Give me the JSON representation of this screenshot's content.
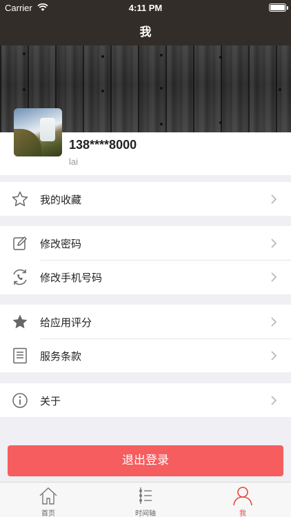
{
  "status_bar": {
    "carrier": "Carrier",
    "time": "4:11 PM"
  },
  "nav": {
    "title": "我"
  },
  "profile": {
    "phone": "138****8000",
    "nickname": "lai"
  },
  "menu": {
    "favorites": {
      "label": "我的收藏",
      "icon": "star-outline-icon"
    },
    "change_password": {
      "label": "修改密码",
      "icon": "edit-icon"
    },
    "change_phone": {
      "label": "修改手机号码",
      "icon": "phone-refresh-icon"
    },
    "rate_app": {
      "label": "给应用评分",
      "icon": "star-filled-icon"
    },
    "terms": {
      "label": "服务条款",
      "icon": "document-icon"
    },
    "about": {
      "label": "关于",
      "icon": "info-icon"
    }
  },
  "logout": {
    "label": "退出登录"
  },
  "tabbar": {
    "home": {
      "label": "首页",
      "icon": "home-icon"
    },
    "timeline": {
      "label": "时间轴",
      "icon": "timeline-icon"
    },
    "me": {
      "label": "我",
      "icon": "person-icon",
      "active": true
    }
  },
  "colors": {
    "nav_bg": "#322d29",
    "accent": "#e8453c",
    "logout_bg": "#f65d5f"
  }
}
